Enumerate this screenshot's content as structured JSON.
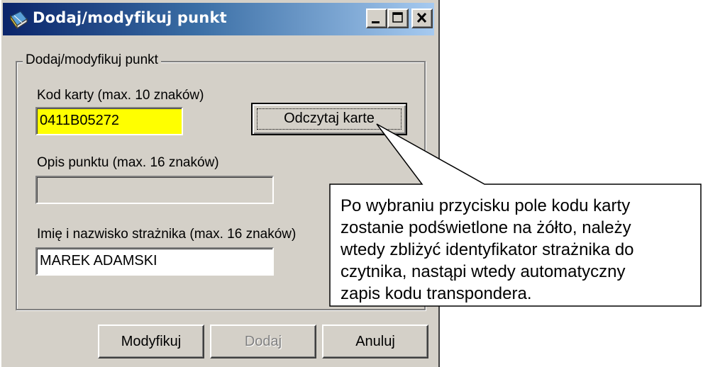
{
  "window": {
    "title": "Dodaj/modyfikuj punkt",
    "icon": "book-icon",
    "controls": [
      "minimize-icon",
      "maximize-icon",
      "close-icon"
    ]
  },
  "group": {
    "legend": "Dodaj/modyfikuj punkt"
  },
  "card_code": {
    "label": "Kod karty (max. 10 znaków)",
    "value": "0411B05272",
    "highlight_color": "#ffff00"
  },
  "read_card_button": {
    "label": "Odczytaj karte"
  },
  "point_description": {
    "label": "Opis punktu (max. 16 znaków)",
    "value": ""
  },
  "guard_name": {
    "label": "Imię i nazwisko strażnika (max. 16 znaków)",
    "value": "MAREK ADAMSKI"
  },
  "footer": {
    "modify_label": "Modyfikuj",
    "add_label": "Dodaj",
    "cancel_label": "Anuluj"
  },
  "callout": {
    "lines": [
      "Po wybraniu przycisku  pole kodu karty",
      "zostanie podświetlone na żółto, należy",
      "wtedy zbliżyć identyfikator strażnika do",
      "czytnika, nastąpi wtedy automatyczny",
      "zapis kodu transpondera."
    ]
  }
}
